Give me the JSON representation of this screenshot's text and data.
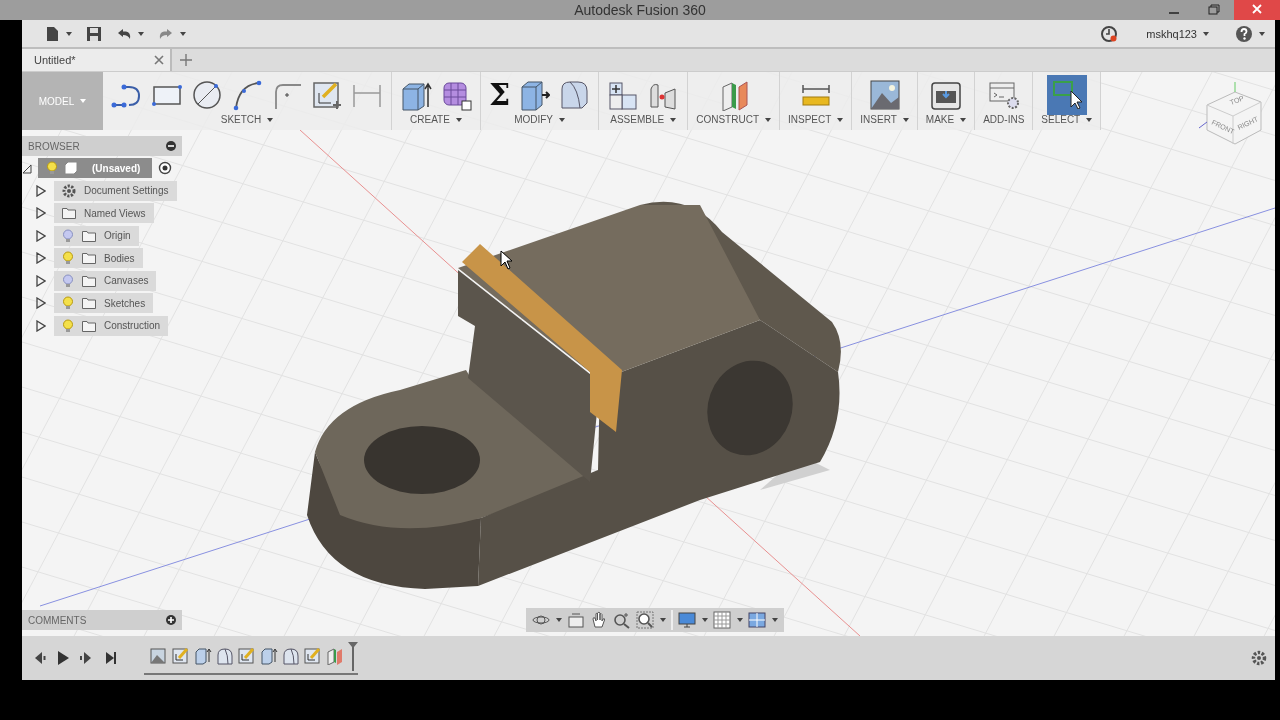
{
  "window": {
    "title": "Autodesk Fusion 360"
  },
  "quick_access": {
    "user": "mskhq123"
  },
  "document_tabs": [
    {
      "label": "Untitled*",
      "selected": true
    }
  ],
  "workspace": {
    "label": "MODEL"
  },
  "toolbar": [
    {
      "label": "SKETCH",
      "dropdown": true,
      "tools": [
        {
          "kind": "line"
        },
        {
          "kind": "rect"
        },
        {
          "kind": "circle"
        },
        {
          "kind": "arc"
        },
        {
          "kind": "fillet2d"
        },
        {
          "kind": "stopsketch"
        },
        {
          "kind": "dimension"
        }
      ]
    },
    {
      "label": "CREATE",
      "dropdown": true,
      "tools": [
        {
          "kind": "extrude"
        },
        {
          "kind": "form"
        }
      ]
    },
    {
      "label": "MODIFY",
      "dropdown": true,
      "tools": [
        {
          "kind": "glyph",
          "text": "Σ"
        },
        {
          "kind": "presspull"
        },
        {
          "kind": "fillet"
        }
      ]
    },
    {
      "label": "ASSEMBLE",
      "dropdown": true,
      "tools": [
        {
          "kind": "component"
        },
        {
          "kind": "joint"
        }
      ]
    },
    {
      "label": "CONSTRUCT",
      "dropdown": true,
      "tools": [
        {
          "kind": "plane"
        }
      ]
    },
    {
      "label": "INSPECT",
      "dropdown": true,
      "tools": [
        {
          "kind": "measure"
        }
      ]
    },
    {
      "label": "INSERT",
      "dropdown": true,
      "tools": [
        {
          "kind": "image"
        }
      ]
    },
    {
      "label": "MAKE",
      "dropdown": true,
      "tools": [
        {
          "kind": "print"
        }
      ]
    },
    {
      "label": "ADD-INS",
      "dropdown": false,
      "tools": [
        {
          "kind": "scripts"
        }
      ]
    },
    {
      "label": "SELECT",
      "dropdown": true,
      "tools": [
        {
          "kind": "select",
          "selected": true
        }
      ]
    }
  ],
  "browser": {
    "title": "BROWSER",
    "root": {
      "label": "(Unsaved)",
      "expanded": true,
      "visible": true,
      "children": [
        {
          "label": "Document Settings",
          "kind": "settings",
          "expanded": false
        },
        {
          "label": "Named Views",
          "kind": "folder",
          "expanded": false
        },
        {
          "label": "Origin",
          "kind": "folder",
          "expanded": false,
          "visible": false
        },
        {
          "label": "Bodies",
          "kind": "folder",
          "expanded": false,
          "visible": true
        },
        {
          "label": "Canvases",
          "kind": "folder",
          "expanded": false,
          "visible": false
        },
        {
          "label": "Sketches",
          "kind": "folder",
          "expanded": false,
          "visible": true
        },
        {
          "label": "Construction",
          "kind": "folder",
          "expanded": false,
          "visible": true
        }
      ]
    }
  },
  "viewcube": {
    "faces": [
      "TOP",
      "FRONT",
      "RIGHT"
    ]
  },
  "comments": {
    "title": "COMMENTS"
  },
  "timeline": {
    "features": [
      {
        "kind": "canvas"
      },
      {
        "kind": "sketch"
      },
      {
        "kind": "extrude"
      },
      {
        "kind": "fillet"
      },
      {
        "kind": "sketch"
      },
      {
        "kind": "extrude"
      },
      {
        "kind": "fillet"
      },
      {
        "kind": "sketch"
      },
      {
        "kind": "plane"
      }
    ]
  }
}
